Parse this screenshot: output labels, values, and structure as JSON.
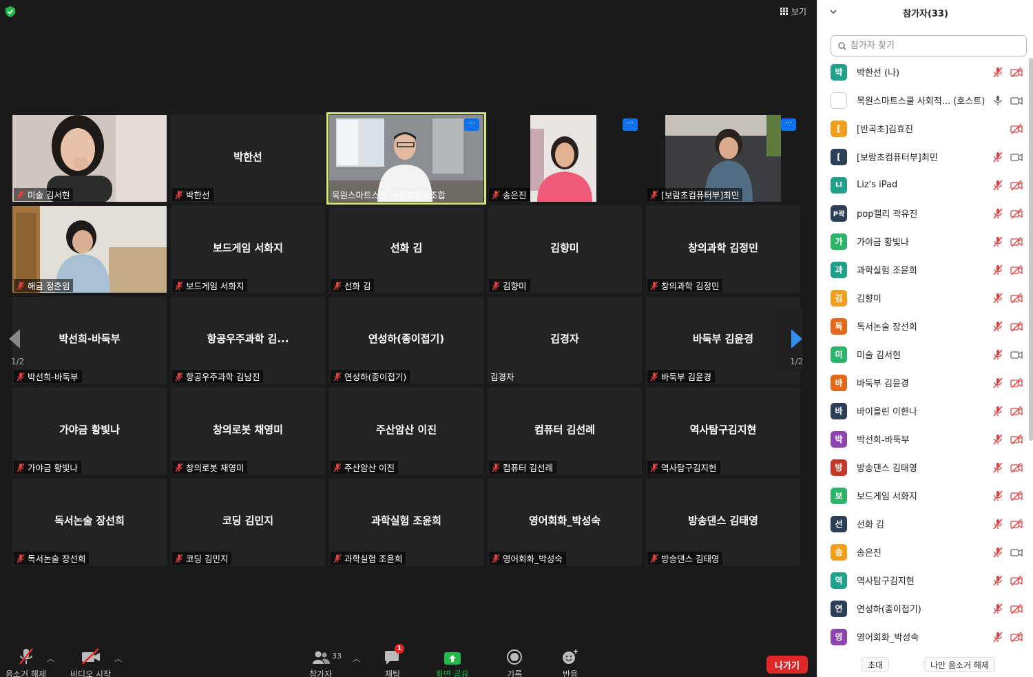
{
  "meeting": {
    "view_label": "보기",
    "page_left": "1/2",
    "page_right": "1/2"
  },
  "tiles": [
    {
      "big": "",
      "label": "미술 김서현",
      "video": "girl",
      "muted": true
    },
    {
      "big": "박한선",
      "label": "박한선",
      "muted": true
    },
    {
      "big": "",
      "label": "목원스마트스쿨 사회적협동조합",
      "video": "man",
      "muted": false,
      "active": true
    },
    {
      "big": "",
      "label": "송은진",
      "video": "woman1",
      "muted": true
    },
    {
      "big": "",
      "label": "[보람초컴퓨터부]최민",
      "video": "woman2",
      "muted": true
    },
    {
      "big": "",
      "label": "해금 정춘임",
      "video": "woman3",
      "muted": true
    },
    {
      "big": "보드게임 서화지",
      "label": "보드게임 서화지",
      "muted": true
    },
    {
      "big": "선화 김",
      "label": "선화 김",
      "muted": true
    },
    {
      "big": "김향미",
      "label": "김향미",
      "muted": true
    },
    {
      "big": "창의과학 김정민",
      "label": "창의과학 김정민",
      "muted": true
    },
    {
      "big": "박선희-바둑부",
      "label": "박선희-바둑부",
      "muted": true
    },
    {
      "big": "항공우주과학 김...",
      "label": "항공우주과학 김남진",
      "muted": true
    },
    {
      "big": "연성하(종이접기)",
      "label": "연성하(종이접기)",
      "muted": true
    },
    {
      "big": "김경자",
      "label": "김경자",
      "muted": false
    },
    {
      "big": "바둑부 김윤경",
      "label": "바둑부 김윤경",
      "muted": true
    },
    {
      "big": "가야금 황빛나",
      "label": "가야금 황빛나",
      "muted": true
    },
    {
      "big": "창의로봇 채영미",
      "label": "창의로봇 채영미",
      "muted": true
    },
    {
      "big": "주산암산 이진",
      "label": "주산암산 이진",
      "muted": true
    },
    {
      "big": "컴퓨터 김선례",
      "label": "컴퓨터 김선례",
      "muted": true
    },
    {
      "big": "역사탐구김지현",
      "label": "역사탐구김지현",
      "muted": true
    },
    {
      "big": "독서논술 장선희",
      "label": "독서논술 장선희",
      "muted": true
    },
    {
      "big": "코딩 김민지",
      "label": "코딩 김민지",
      "muted": true
    },
    {
      "big": "과학실험 조윤희",
      "label": "과학실험 조윤희",
      "muted": true
    },
    {
      "big": "영어회화_박성숙",
      "label": "영어회화_박성숙",
      "muted": true
    },
    {
      "big": "방송댄스 김태영",
      "label": "방송댄스 김태영",
      "muted": true
    }
  ],
  "toolbar": {
    "mute_label": "음소거 해제",
    "video_label": "비디오 시작",
    "participants_label": "참가자",
    "participants_count": "33",
    "chat_label": "채팅",
    "chat_badge": "1",
    "share_label": "화면 공유",
    "record_label": "기록",
    "reactions_label": "반응",
    "leave_label": "나가기"
  },
  "panel": {
    "title": "참가자(33)",
    "search_placeholder": "참가자 찾기",
    "invite_label": "초대",
    "unmute_me_label": "나만 음소거 해제",
    "participants": [
      {
        "initial": "박",
        "color": "#21a08a",
        "name": "박한선 (나)",
        "mic": "muted",
        "cam": "off"
      },
      {
        "initial": "",
        "color": "#ffffff",
        "name": "목원스마트스쿨 사회적... (호스트)",
        "mic": "on",
        "cam": "on"
      },
      {
        "initial": "[",
        "color": "#f0a020",
        "name": "[반곡초]김효진",
        "mic": "none",
        "cam": "muted"
      },
      {
        "initial": "[",
        "color": "#2d3e57",
        "name": "[보람초컴퓨터부]최민",
        "mic": "muted",
        "cam": "on"
      },
      {
        "initial": "LI",
        "color": "#21a08a",
        "name": "Liz's iPad",
        "mic": "muted",
        "cam": "off"
      },
      {
        "initial": "P곽",
        "color": "#2d3e57",
        "name": "pop캘리 곽유진",
        "mic": "muted",
        "cam": "off"
      },
      {
        "initial": "가",
        "color": "#2db46a",
        "name": "가야금 황빛나",
        "mic": "muted",
        "cam": "off"
      },
      {
        "initial": "과",
        "color": "#21a08a",
        "name": "과학실험 조윤희",
        "mic": "muted",
        "cam": "off"
      },
      {
        "initial": "김",
        "color": "#f0a020",
        "name": "김향미",
        "mic": "muted",
        "cam": "off"
      },
      {
        "initial": "독",
        "color": "#e0691c",
        "name": "독서논술 장선희",
        "mic": "muted",
        "cam": "off"
      },
      {
        "initial": "미",
        "color": "#2db46a",
        "name": "미술 김서현",
        "mic": "muted",
        "cam": "on"
      },
      {
        "initial": "바",
        "color": "#e0691c",
        "name": "바둑부 김윤경",
        "mic": "muted",
        "cam": "off"
      },
      {
        "initial": "바",
        "color": "#2d3e57",
        "name": "바이올린 이한나",
        "mic": "muted",
        "cam": "off"
      },
      {
        "initial": "박",
        "color": "#8e44ad",
        "name": "박선희-바둑부",
        "mic": "muted",
        "cam": "off"
      },
      {
        "initial": "방",
        "color": "#c0392b",
        "name": "방송댄스 김태영",
        "mic": "muted",
        "cam": "off"
      },
      {
        "initial": "보",
        "color": "#2db46a",
        "name": "보드게임 서화지",
        "mic": "muted",
        "cam": "off"
      },
      {
        "initial": "선",
        "color": "#2d3e57",
        "name": "선화 김",
        "mic": "muted",
        "cam": "off"
      },
      {
        "initial": "송",
        "color": "#f0a020",
        "name": "송은진",
        "mic": "muted",
        "cam": "on"
      },
      {
        "initial": "역",
        "color": "#21a08a",
        "name": "역사탐구김지현",
        "mic": "muted",
        "cam": "off"
      },
      {
        "initial": "연",
        "color": "#2d3e57",
        "name": "연성하(종이접기)",
        "mic": "muted",
        "cam": "off"
      },
      {
        "initial": "영",
        "color": "#8e44ad",
        "name": "영어회화_박성숙",
        "mic": "muted",
        "cam": "off"
      }
    ]
  }
}
